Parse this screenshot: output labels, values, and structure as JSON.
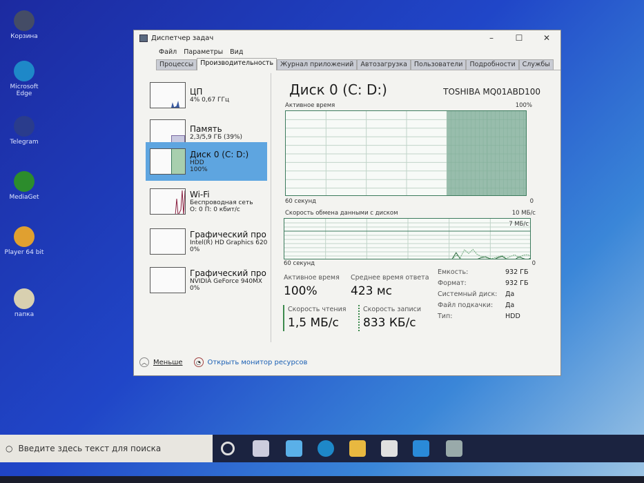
{
  "desktop": {
    "icons": [
      {
        "label": "Корзина",
        "color": "#444c66"
      },
      {
        "label": "Microsoft Edge",
        "color": "#1e88c8"
      },
      {
        "label": "Telegram",
        "color": "#2a3c8c"
      },
      {
        "label": "MediaGet",
        "color": "#2c8c2c"
      },
      {
        "label": "Player 64 bit",
        "color": "#e0a030"
      },
      {
        "label": "папка",
        "color": "#d8d0b0"
      }
    ]
  },
  "window": {
    "title": "Диспетчер задач",
    "controls": {
      "minimize": "–",
      "maximize": "☐",
      "close": "✕"
    },
    "menu": [
      "Файл",
      "Параметры",
      "Вид"
    ],
    "tabs": [
      "Процессы",
      "Производительность",
      "Журнал приложений",
      "Автозагрузка",
      "Пользователи",
      "Подробности",
      "Службы"
    ],
    "active_tab": 1,
    "sidebar": [
      {
        "title": "ЦП",
        "line1": "4% 0,67 ГГц",
        "line2": ""
      },
      {
        "title": "Память",
        "line1": "2,3/5,9 ГБ (39%)",
        "line2": ""
      },
      {
        "title": "Диск 0 (C: D:)",
        "line1": "HDD",
        "line2": "100%"
      },
      {
        "title": "Wi-Fi",
        "line1": "Беспроводная сеть",
        "line2": "О: 0 П: 0 кбит/с"
      },
      {
        "title": "Графический про",
        "line1": "Intel(R) HD Graphics 620",
        "line2": "0%"
      },
      {
        "title": "Графический про",
        "line1": "NVIDIA GeForce 940MX",
        "line2": "0%"
      }
    ],
    "detail": {
      "title": "Диск 0 (C: D:)",
      "model": "TOSHIBA MQ01ABD100",
      "active_chart": {
        "label": "Активное время",
        "max": "100%",
        "xleft": "60 секунд",
        "xright": "0"
      },
      "transfer_chart": {
        "label": "Скорость обмена данными с диском",
        "max": "10 МБ/с",
        "line": "7 МБ/с",
        "xleft": "60 секунд",
        "xright": "0"
      },
      "stats": {
        "active_label": "Активное время",
        "active_value": "100%",
        "resp_label": "Среднее время ответа",
        "resp_value": "423 мс",
        "read_label": "Скорость чтения",
        "read_value": "1,5 МБ/с",
        "write_label": "Скорость записи",
        "write_value": "833 КБ/с"
      },
      "props": [
        {
          "k": "Емкость:",
          "v": "932 ГБ"
        },
        {
          "k": "Формат:",
          "v": "932 ГБ"
        },
        {
          "k": "Системный диск:",
          "v": "Да"
        },
        {
          "k": "Файл подкачки:",
          "v": "Да"
        },
        {
          "k": "Тип:",
          "v": "HDD"
        }
      ]
    },
    "footer": {
      "less": "Меньше",
      "monitor": "Открыть монитор ресурсов"
    }
  },
  "chart_data": [
    {
      "type": "area",
      "title": "Активное время",
      "ylim": [
        0,
        100
      ],
      "x_seconds": 60,
      "values": [
        0,
        0,
        0,
        0,
        0,
        0,
        0,
        0,
        0,
        0,
        0,
        0,
        0,
        0,
        0,
        0,
        0,
        0,
        0,
        0,
        0,
        0,
        0,
        0,
        0,
        0,
        0,
        0,
        0,
        0,
        0,
        0,
        0,
        0,
        0,
        0,
        0,
        0,
        0,
        0,
        100,
        100,
        100,
        100,
        100,
        100,
        100,
        100,
        100,
        100,
        100,
        100,
        100,
        100,
        100,
        100,
        100,
        100,
        100,
        100
      ]
    },
    {
      "type": "line",
      "title": "Скорость обмена данными с диском",
      "ylim": [
        0,
        10
      ],
      "series": [
        {
          "name": "Скорость чтения",
          "values": [
            0,
            0,
            0,
            0,
            0,
            0,
            0,
            0,
            0,
            0,
            0,
            0,
            0,
            0,
            0,
            0,
            0,
            0,
            0,
            0,
            0,
            0,
            0,
            0,
            0,
            0,
            0,
            0,
            0,
            0,
            0,
            0,
            0,
            0,
            0,
            0,
            0,
            0,
            0,
            0,
            0.2,
            1.8,
            0.3,
            0.2,
            0.1,
            0,
            0.2,
            0.6,
            0.8,
            0.4,
            0.1,
            0.6,
            0.9,
            0.3,
            0.2,
            0.1,
            0.8,
            0.4,
            0.1,
            0.6
          ]
        },
        {
          "name": "Скорость записи",
          "values": [
            0,
            0,
            0,
            0,
            0,
            0,
            0,
            0,
            0,
            0,
            0,
            0,
            0,
            0,
            0,
            0,
            0,
            0,
            0,
            0,
            0,
            0,
            0,
            0,
            0,
            0,
            0,
            0,
            0,
            0,
            0,
            0,
            0,
            0,
            0,
            0,
            0,
            0,
            0,
            0,
            0.1,
            1.2,
            0.6,
            2.5,
            1.6,
            2.6,
            1.4,
            0.9,
            0.7,
            0.3,
            0.5,
            0.8,
            1.1,
            0.4,
            0.9,
            1.3,
            0.6,
            1.2,
            1.3,
            1.0
          ]
        }
      ]
    }
  ],
  "taskbar": {
    "search_placeholder": "Введите здесь текст для поиска"
  }
}
